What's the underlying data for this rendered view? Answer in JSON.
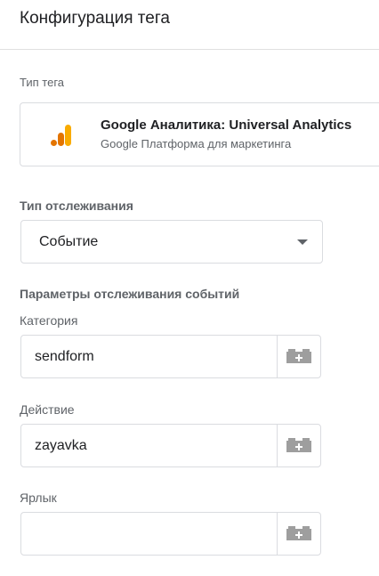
{
  "header": {
    "title": "Конфигурация тега"
  },
  "tag_type": {
    "label": "Тип тега",
    "name": "Google Аналитика: Universal Analytics",
    "subtitle": "Google Платформа для маркетинга",
    "icon": "google-analytics-icon"
  },
  "track_type": {
    "label": "Тип отслеживания",
    "value": "Событие"
  },
  "event_params": {
    "heading": "Параметры отслеживания событий",
    "fields": [
      {
        "label": "Категория",
        "value": "sendform",
        "placeholder": ""
      },
      {
        "label": "Действие",
        "value": "zayavka",
        "placeholder": ""
      },
      {
        "label": "Ярлык",
        "value": "",
        "placeholder": ""
      }
    ]
  },
  "colors": {
    "ga_orange": "#F9AB00",
    "ga_dark_orange": "#E37400",
    "variable_icon": "#9e9e9e",
    "border": "#dadce0"
  }
}
